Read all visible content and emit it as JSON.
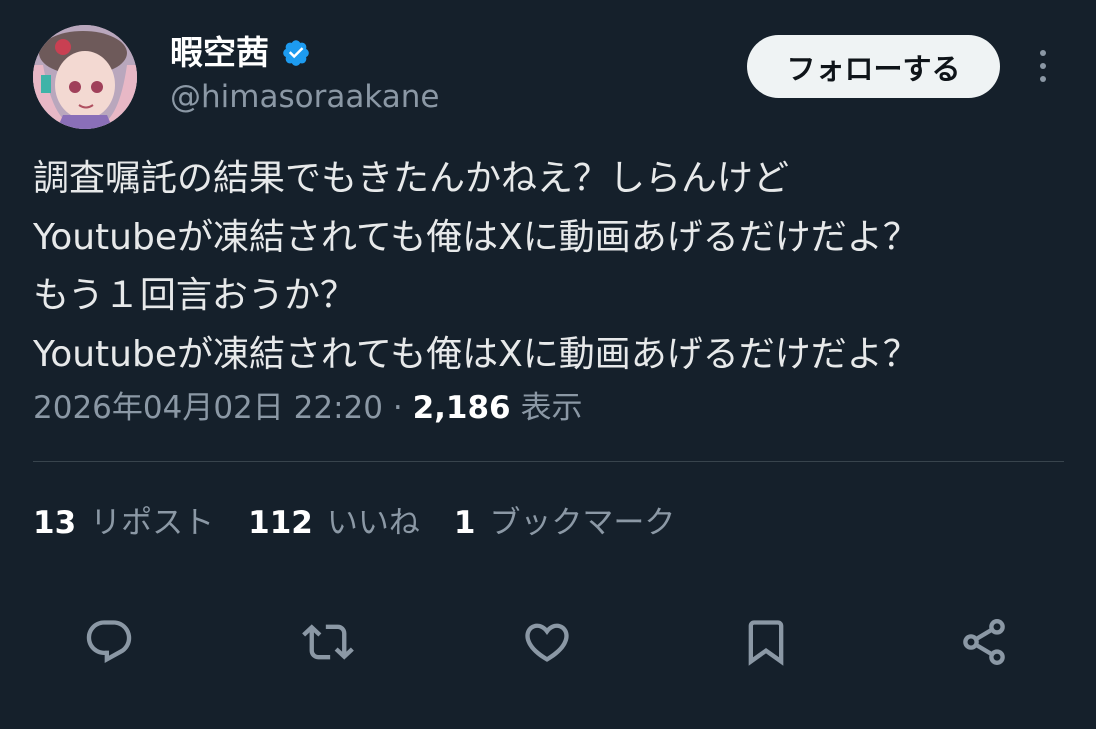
{
  "author": {
    "display_name": "暇空茜",
    "handle": "@himasoraakane",
    "verified_icon": "verified-badge-icon",
    "verified_color": "#1d9bf0"
  },
  "follow_label": "フォローする",
  "tweet": {
    "lines": [
      "調査嘱託の結果でもきたんかねえ？しらんけど",
      "Youtubeが凍結されても俺はXに動画あげるだけだよ？",
      "もう１回言おうか？",
      "Youtubeが凍結されても俺はXに動画あげるだけだよ？"
    ]
  },
  "meta": {
    "timestamp": "2026年04月02日 22:20",
    "separator": "·",
    "views": "2,186",
    "views_label": "表示"
  },
  "stats": {
    "reposts": {
      "count": "13",
      "label": "リポスト"
    },
    "likes": {
      "count": "112",
      "label": "いいね"
    },
    "bookmarks": {
      "count": "1",
      "label": "ブックマーク"
    }
  },
  "actions": [
    "reply-icon",
    "repost-icon",
    "like-icon",
    "bookmark-icon",
    "share-icon"
  ],
  "colors": {
    "background": "#15202b",
    "text": "#e7e9ea",
    "secondary": "#8b98a5",
    "follow_button": "#eff3f4"
  }
}
